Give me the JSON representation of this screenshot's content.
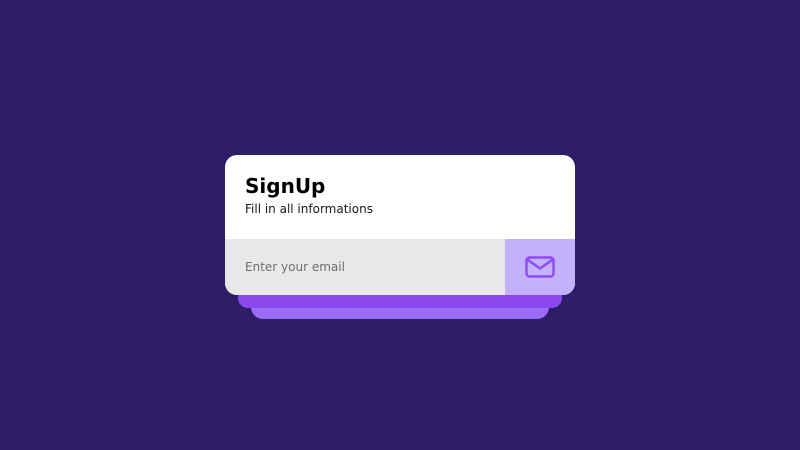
{
  "colors": {
    "background": "#2f1d68",
    "card": "#ffffff",
    "input_background": "#e8e8e8",
    "button_background": "#c4b1fb",
    "icon_stroke": "#8b4cf0",
    "layer_mid": "#8b48ee",
    "layer_back": "#9b6cf4"
  },
  "signup": {
    "title": "SignUp",
    "subtitle": "Fill in all informations",
    "email_placeholder": "Enter your email",
    "email_value": "",
    "submit_icon": "mail-icon"
  }
}
